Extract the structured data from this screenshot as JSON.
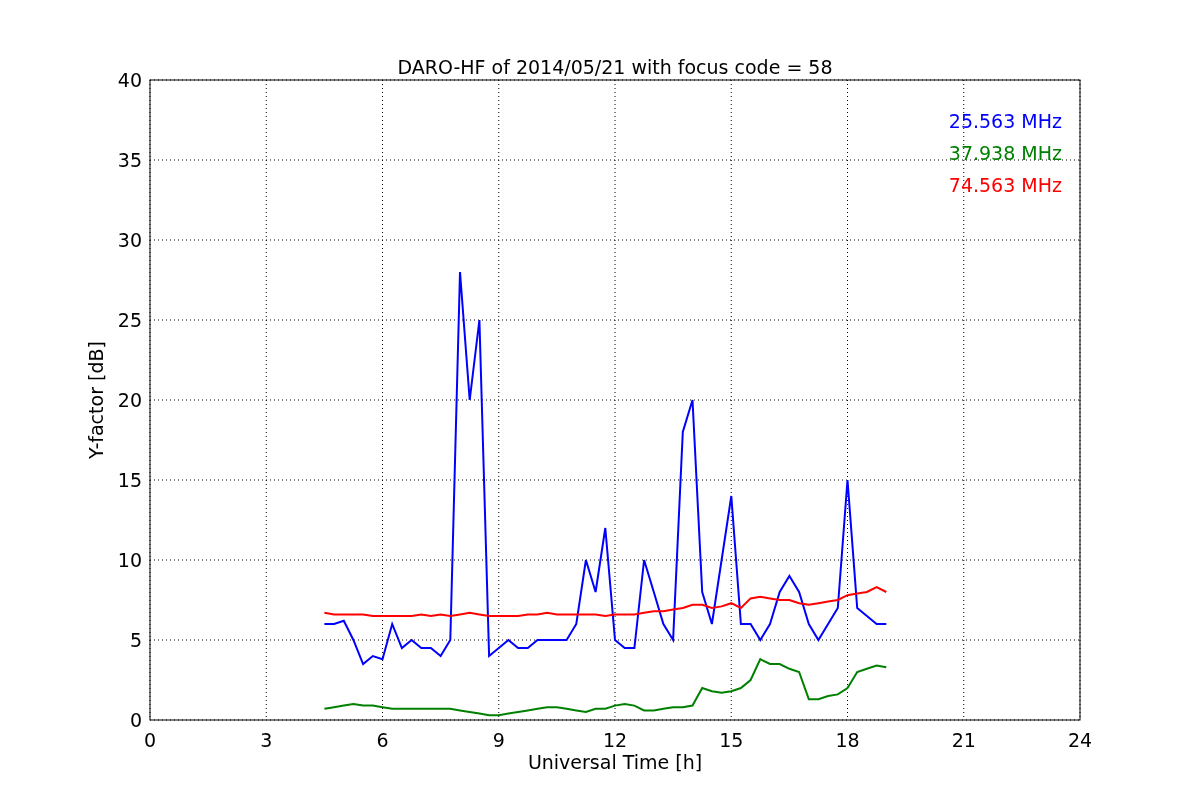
{
  "chart_data": {
    "type": "line",
    "title": "DARO-HF of 2014/05/21 with focus code = 58",
    "xlabel": "Universal Time [h]",
    "ylabel": "Y-factor [dB]",
    "x": [
      4.5,
      4.75,
      5,
      5.25,
      5.5,
      5.75,
      6,
      6.25,
      6.5,
      6.75,
      7,
      7.25,
      7.5,
      7.75,
      8,
      8.25,
      8.5,
      8.75,
      9,
      9.25,
      9.5,
      9.75,
      10,
      10.25,
      10.5,
      10.75,
      11,
      11.25,
      11.5,
      11.75,
      12,
      12.25,
      12.5,
      12.75,
      13,
      13.25,
      13.5,
      13.75,
      14,
      14.25,
      14.5,
      14.75,
      15,
      15.25,
      15.5,
      15.75,
      16,
      16.25,
      16.5,
      16.75,
      17,
      17.25,
      17.5,
      17.75,
      18,
      18.25,
      18.5,
      18.75,
      19
    ],
    "series": [
      {
        "name": "25.563 MHz",
        "color": "#0000ff",
        "values": [
          6,
          6,
          6.2,
          5,
          3.5,
          4,
          3.8,
          6,
          4.5,
          5,
          4.5,
          4.5,
          4,
          5,
          28,
          20,
          25,
          4,
          4.5,
          5,
          4.5,
          4.5,
          5,
          5,
          5,
          5,
          6,
          10,
          8,
          12,
          5,
          4.5,
          4.5,
          10,
          8,
          6,
          5,
          18,
          20,
          8,
          6,
          10,
          14,
          6,
          6,
          5,
          6,
          8,
          9,
          8,
          6,
          5,
          6,
          7,
          15,
          7,
          6.5,
          6,
          6
        ]
      },
      {
        "name": "37.938 MHz",
        "color": "#008000",
        "values": [
          0.7,
          0.8,
          0.9,
          1.0,
          0.9,
          0.9,
          0.8,
          0.7,
          0.7,
          0.7,
          0.7,
          0.7,
          0.7,
          0.7,
          0.6,
          0.5,
          0.4,
          0.3,
          0.3,
          0.4,
          0.5,
          0.6,
          0.7,
          0.8,
          0.8,
          0.7,
          0.6,
          0.5,
          0.7,
          0.7,
          0.9,
          1.0,
          0.9,
          0.6,
          0.6,
          0.7,
          0.8,
          0.8,
          0.9,
          2.0,
          1.8,
          1.7,
          1.8,
          2.0,
          2.5,
          3.8,
          3.5,
          3.5,
          3.2,
          3.0,
          1.3,
          1.3,
          1.5,
          1.6,
          2.0,
          3.0,
          3.2,
          3.4,
          3.3
        ]
      },
      {
        "name": "74.563 MHz",
        "color": "#ff0000",
        "values": [
          6.7,
          6.6,
          6.6,
          6.6,
          6.6,
          6.5,
          6.5,
          6.5,
          6.5,
          6.5,
          6.6,
          6.5,
          6.6,
          6.5,
          6.6,
          6.7,
          6.6,
          6.5,
          6.5,
          6.5,
          6.5,
          6.6,
          6.6,
          6.7,
          6.6,
          6.6,
          6.6,
          6.6,
          6.6,
          6.5,
          6.6,
          6.6,
          6.6,
          6.7,
          6.8,
          6.8,
          6.9,
          7.0,
          7.2,
          7.2,
          7.0,
          7.1,
          7.3,
          7.0,
          7.6,
          7.7,
          7.6,
          7.5,
          7.5,
          7.3,
          7.2,
          7.3,
          7.4,
          7.5,
          7.8,
          7.9,
          8.0,
          8.3,
          8.0
        ]
      }
    ],
    "grid": true,
    "xlim": [
      0,
      24
    ],
    "ylim": [
      0,
      40
    ],
    "xticks": [
      0,
      3,
      6,
      9,
      12,
      15,
      18,
      21,
      24
    ],
    "yticks": [
      0,
      5,
      10,
      15,
      20,
      25,
      30,
      35,
      40
    ]
  }
}
